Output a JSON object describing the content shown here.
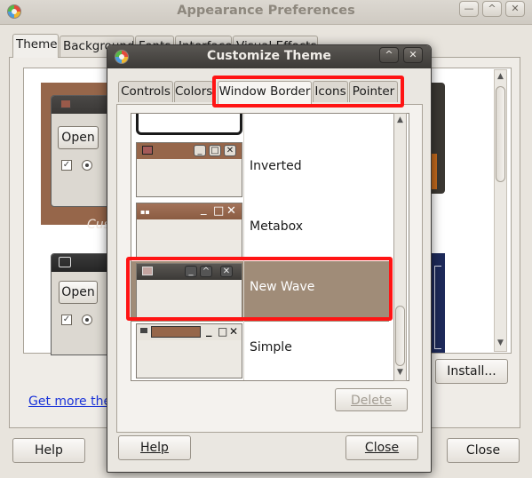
{
  "background_window": {
    "title": "Appearance Preferences",
    "controls": {
      "minimize": "—",
      "maximize": "^",
      "close": "✕"
    },
    "tabs": [
      "Theme",
      "Background",
      "Fonts",
      "Interface",
      "Visual Effects"
    ],
    "theme_preview": {
      "open_label": "Open",
      "caption_partial": "Cus",
      "checkbox_mark": "✓"
    },
    "theme_preview2": {
      "open_label": "Open",
      "checkbox_mark": "✓"
    },
    "get_more_link": "Get more the",
    "install_button": "Install...",
    "help_button": "Help",
    "close_button": "Close"
  },
  "dialog": {
    "title": "Customize Theme",
    "controls": {
      "maximize": "^",
      "close": "✕"
    },
    "tabs": [
      {
        "label": "Controls"
      },
      {
        "label": "Colors"
      },
      {
        "label": "Window Border"
      },
      {
        "label": "Icons"
      },
      {
        "label": "Pointer"
      }
    ],
    "active_tab": "Window Border",
    "themes": [
      {
        "name": "Inverted"
      },
      {
        "name": "Metabox"
      },
      {
        "name": "New Wave"
      },
      {
        "name": "Simple"
      }
    ],
    "selected_theme": "New Wave",
    "delete_button": "Delete",
    "help_button": "Help",
    "close_button": "Close",
    "glyphs": {
      "scroll_up": "▲",
      "scroll_down": "▼",
      "minimize": "_",
      "maximize": "□",
      "close": "✕",
      "maximize_alt": "^"
    }
  },
  "colors": {
    "highlight_red": "#ff1414",
    "selection": "#a08c78",
    "theme_brown": "#96664a",
    "dark_titlebar": "#3c3a37"
  }
}
